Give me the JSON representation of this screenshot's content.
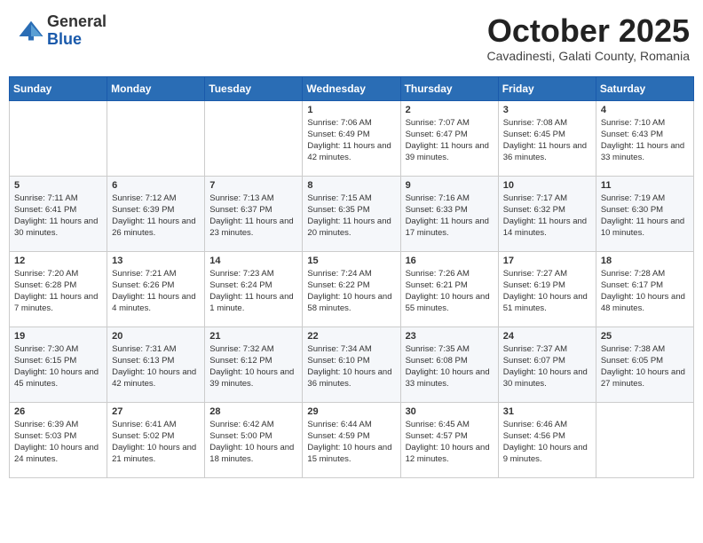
{
  "header": {
    "logo_general": "General",
    "logo_blue": "Blue",
    "month": "October 2025",
    "location": "Cavadinesti, Galati County, Romania"
  },
  "days_of_week": [
    "Sunday",
    "Monday",
    "Tuesday",
    "Wednesday",
    "Thursday",
    "Friday",
    "Saturday"
  ],
  "weeks": [
    [
      {
        "day": "",
        "info": ""
      },
      {
        "day": "",
        "info": ""
      },
      {
        "day": "",
        "info": ""
      },
      {
        "day": "1",
        "info": "Sunrise: 7:06 AM\nSunset: 6:49 PM\nDaylight: 11 hours and 42 minutes."
      },
      {
        "day": "2",
        "info": "Sunrise: 7:07 AM\nSunset: 6:47 PM\nDaylight: 11 hours and 39 minutes."
      },
      {
        "day": "3",
        "info": "Sunrise: 7:08 AM\nSunset: 6:45 PM\nDaylight: 11 hours and 36 minutes."
      },
      {
        "day": "4",
        "info": "Sunrise: 7:10 AM\nSunset: 6:43 PM\nDaylight: 11 hours and 33 minutes."
      }
    ],
    [
      {
        "day": "5",
        "info": "Sunrise: 7:11 AM\nSunset: 6:41 PM\nDaylight: 11 hours and 30 minutes."
      },
      {
        "day": "6",
        "info": "Sunrise: 7:12 AM\nSunset: 6:39 PM\nDaylight: 11 hours and 26 minutes."
      },
      {
        "day": "7",
        "info": "Sunrise: 7:13 AM\nSunset: 6:37 PM\nDaylight: 11 hours and 23 minutes."
      },
      {
        "day": "8",
        "info": "Sunrise: 7:15 AM\nSunset: 6:35 PM\nDaylight: 11 hours and 20 minutes."
      },
      {
        "day": "9",
        "info": "Sunrise: 7:16 AM\nSunset: 6:33 PM\nDaylight: 11 hours and 17 minutes."
      },
      {
        "day": "10",
        "info": "Sunrise: 7:17 AM\nSunset: 6:32 PM\nDaylight: 11 hours and 14 minutes."
      },
      {
        "day": "11",
        "info": "Sunrise: 7:19 AM\nSunset: 6:30 PM\nDaylight: 11 hours and 10 minutes."
      }
    ],
    [
      {
        "day": "12",
        "info": "Sunrise: 7:20 AM\nSunset: 6:28 PM\nDaylight: 11 hours and 7 minutes."
      },
      {
        "day": "13",
        "info": "Sunrise: 7:21 AM\nSunset: 6:26 PM\nDaylight: 11 hours and 4 minutes."
      },
      {
        "day": "14",
        "info": "Sunrise: 7:23 AM\nSunset: 6:24 PM\nDaylight: 11 hours and 1 minute."
      },
      {
        "day": "15",
        "info": "Sunrise: 7:24 AM\nSunset: 6:22 PM\nDaylight: 10 hours and 58 minutes."
      },
      {
        "day": "16",
        "info": "Sunrise: 7:26 AM\nSunset: 6:21 PM\nDaylight: 10 hours and 55 minutes."
      },
      {
        "day": "17",
        "info": "Sunrise: 7:27 AM\nSunset: 6:19 PM\nDaylight: 10 hours and 51 minutes."
      },
      {
        "day": "18",
        "info": "Sunrise: 7:28 AM\nSunset: 6:17 PM\nDaylight: 10 hours and 48 minutes."
      }
    ],
    [
      {
        "day": "19",
        "info": "Sunrise: 7:30 AM\nSunset: 6:15 PM\nDaylight: 10 hours and 45 minutes."
      },
      {
        "day": "20",
        "info": "Sunrise: 7:31 AM\nSunset: 6:13 PM\nDaylight: 10 hours and 42 minutes."
      },
      {
        "day": "21",
        "info": "Sunrise: 7:32 AM\nSunset: 6:12 PM\nDaylight: 10 hours and 39 minutes."
      },
      {
        "day": "22",
        "info": "Sunrise: 7:34 AM\nSunset: 6:10 PM\nDaylight: 10 hours and 36 minutes."
      },
      {
        "day": "23",
        "info": "Sunrise: 7:35 AM\nSunset: 6:08 PM\nDaylight: 10 hours and 33 minutes."
      },
      {
        "day": "24",
        "info": "Sunrise: 7:37 AM\nSunset: 6:07 PM\nDaylight: 10 hours and 30 minutes."
      },
      {
        "day": "25",
        "info": "Sunrise: 7:38 AM\nSunset: 6:05 PM\nDaylight: 10 hours and 27 minutes."
      }
    ],
    [
      {
        "day": "26",
        "info": "Sunrise: 6:39 AM\nSunset: 5:03 PM\nDaylight: 10 hours and 24 minutes."
      },
      {
        "day": "27",
        "info": "Sunrise: 6:41 AM\nSunset: 5:02 PM\nDaylight: 10 hours and 21 minutes."
      },
      {
        "day": "28",
        "info": "Sunrise: 6:42 AM\nSunset: 5:00 PM\nDaylight: 10 hours and 18 minutes."
      },
      {
        "day": "29",
        "info": "Sunrise: 6:44 AM\nSunset: 4:59 PM\nDaylight: 10 hours and 15 minutes."
      },
      {
        "day": "30",
        "info": "Sunrise: 6:45 AM\nSunset: 4:57 PM\nDaylight: 10 hours and 12 minutes."
      },
      {
        "day": "31",
        "info": "Sunrise: 6:46 AM\nSunset: 4:56 PM\nDaylight: 10 hours and 9 minutes."
      },
      {
        "day": "",
        "info": ""
      }
    ]
  ]
}
